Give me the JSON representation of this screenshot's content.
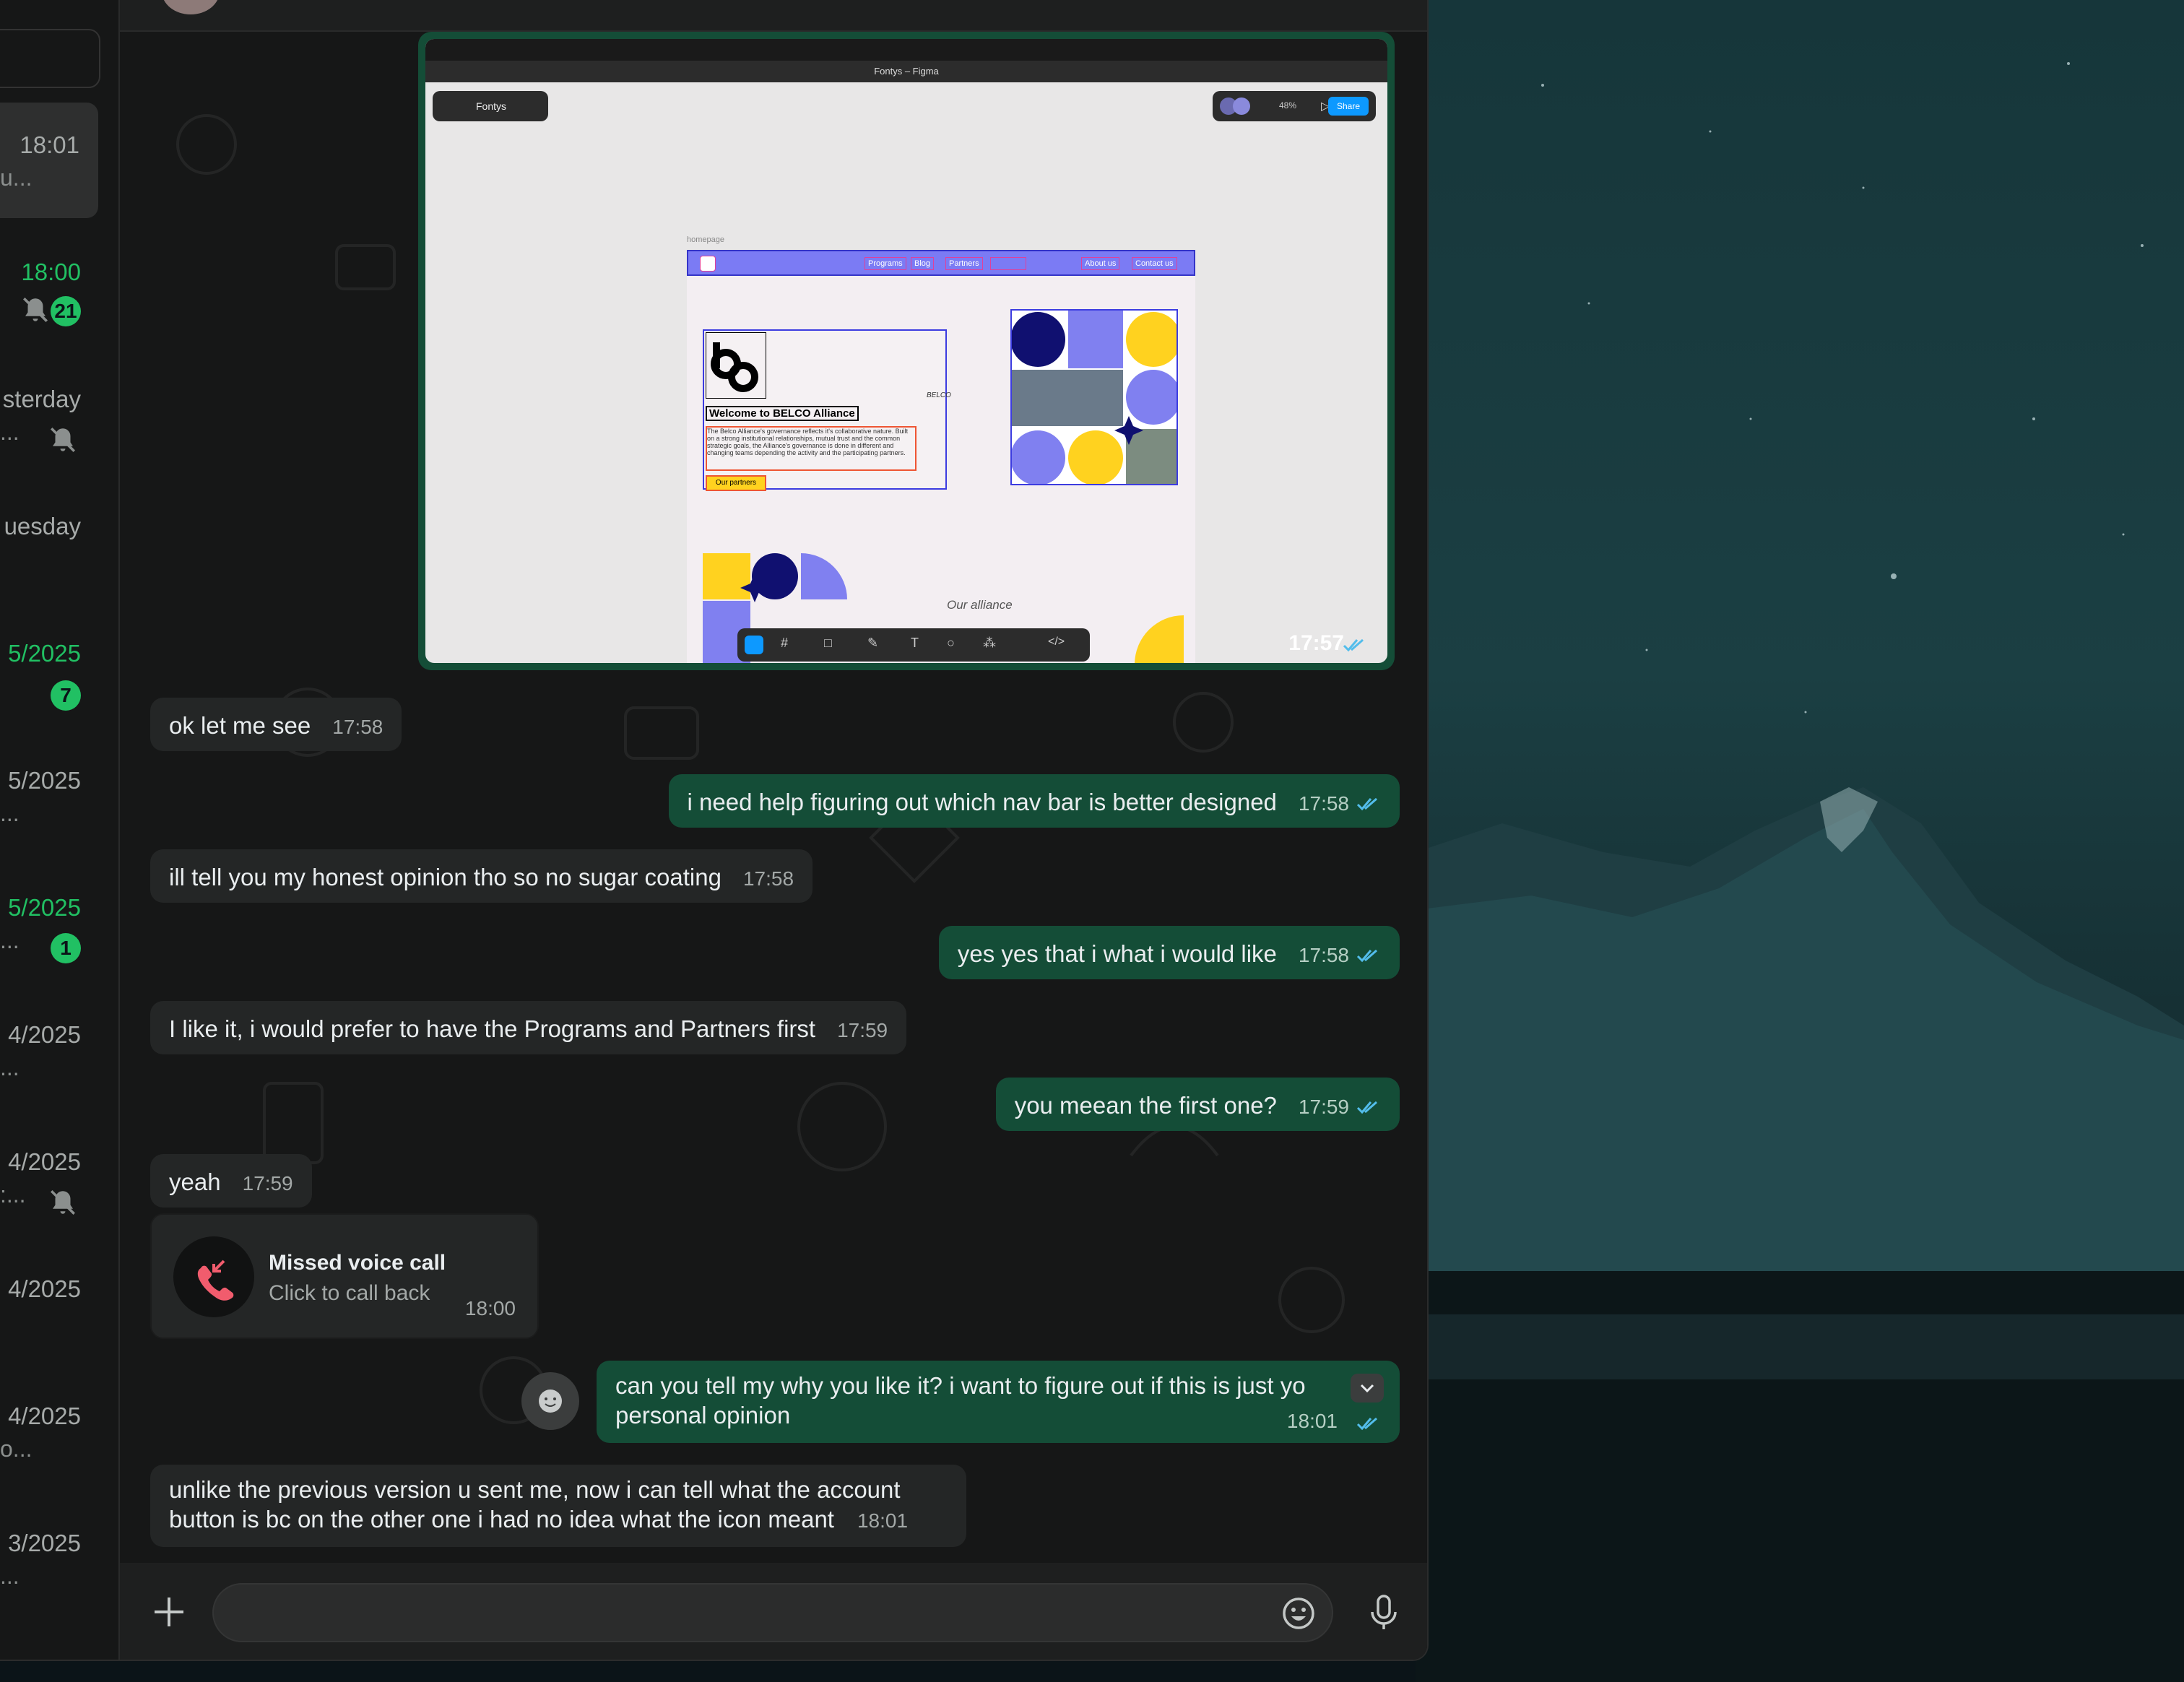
{
  "sidebar": {
    "chats": [
      {
        "time": "18:01",
        "preview": "u...",
        "unread": false,
        "active": true
      },
      {
        "time": "18:00",
        "preview": "",
        "unread": true,
        "badge": "21",
        "muted": true
      },
      {
        "time": "sterday",
        "preview": "...",
        "unread": false,
        "muted": true
      },
      {
        "time": "uesday",
        "preview": "",
        "unread": false
      },
      {
        "time": "5/2025",
        "preview": "",
        "unread": true,
        "badge": "7"
      },
      {
        "time": "5/2025",
        "preview": "...",
        "unread": false
      },
      {
        "time": "5/2025",
        "preview": "...",
        "unread": true,
        "badge": "1"
      },
      {
        "time": "4/2025",
        "preview": "...",
        "unread": false
      },
      {
        "time": "4/2025",
        "preview": ":...",
        "unread": false,
        "muted": true
      },
      {
        "time": "4/2025",
        "preview": "",
        "unread": false
      },
      {
        "time": "4/2025",
        "preview": "o...",
        "unread": false
      },
      {
        "time": "3/2025",
        "preview": "...",
        "unread": false
      }
    ]
  },
  "image_message": {
    "time": "17:57",
    "figma": {
      "window_title": "Fontys – Figma",
      "file_name": "Fontys",
      "zoom": "48%",
      "share_label": "Share",
      "frame_label": "homepage",
      "nav_items": [
        "Programs",
        "Blog",
        "Partners",
        "About us",
        "Contact us"
      ],
      "welcome": "Welcome to BELCO Alliance",
      "body_text": "The Belco Alliance's governance reflects it's collaborative nature. Built on a strong institutional relationships, mutual trust and the common strategic goals, the Alliance's governance is done in different and changing teams depending the activity and the participating partners.",
      "cta": "Our partners",
      "signature": "BELCO",
      "alliance_heading": "Our alliance"
    }
  },
  "messages": [
    {
      "dir": "in",
      "text": "ok let me see",
      "time": "17:58"
    },
    {
      "dir": "out",
      "text": "i need help figuring out which nav bar is better designed",
      "time": "17:58"
    },
    {
      "dir": "in",
      "text": "ill tell you my honest opinion tho so no sugar coating",
      "time": "17:58"
    },
    {
      "dir": "out",
      "text": "yes yes that i what i would like",
      "time": "17:58"
    },
    {
      "dir": "in",
      "text": "I like it, i would prefer to have the Programs and Partners first",
      "time": "17:59"
    },
    {
      "dir": "out",
      "text": "you meean the first one?",
      "time": "17:59"
    },
    {
      "dir": "in",
      "text": "yeah",
      "time": "17:59"
    },
    {
      "dir": "out",
      "text_line1": "can you tell my why you like it? i want to figure out if this is just yo",
      "text_line2": "personal opinion",
      "time": "18:01"
    },
    {
      "dir": "in",
      "text_line1": "unlike the previous version u sent me, now i can tell what the account",
      "text_line2": "button is bc on the other one i had no idea what the icon meant",
      "time": "18:01"
    }
  ],
  "call": {
    "title": "Missed voice call",
    "subtitle": "Click to call back",
    "time": "18:00"
  },
  "composer": {
    "placeholder": ""
  },
  "colors": {
    "accent": "#21c063",
    "outgoing_bubble": "#144d37",
    "incoming_bubble": "#242626",
    "read_ticks": "#53bdeb",
    "missed_call": "#f15c6d"
  }
}
